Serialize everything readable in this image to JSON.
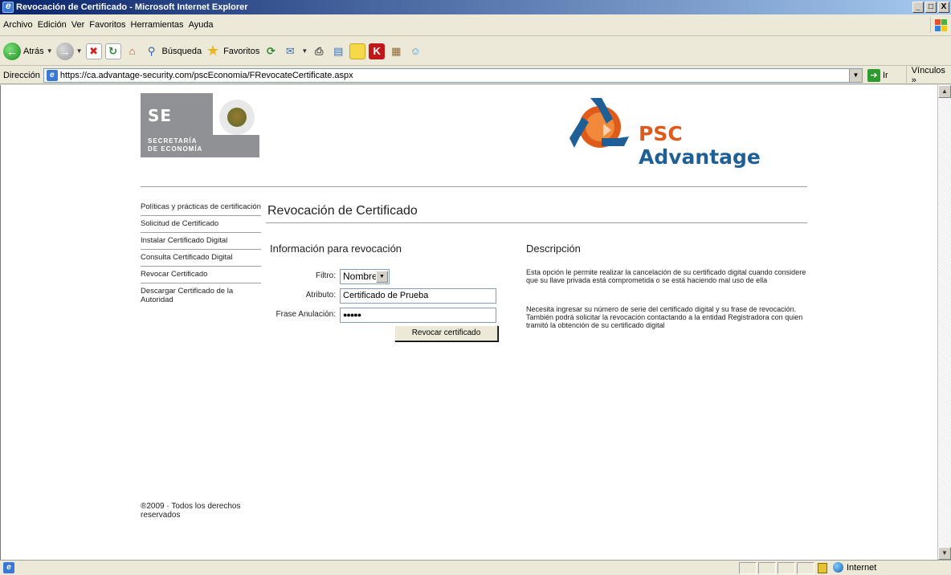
{
  "window": {
    "title": "Revocación de Certificado - Microsoft Internet Explorer",
    "buttons": [
      "_",
      "□",
      "X"
    ]
  },
  "menu": {
    "items": [
      "Archivo",
      "Edición",
      "Ver",
      "Favoritos",
      "Herramientas",
      "Ayuda"
    ]
  },
  "toolbar": {
    "back_label": "Atrás",
    "search_label": "Búsqueda",
    "favorites_label": "Favoritos"
  },
  "address": {
    "label": "Dirección",
    "url": "https://ca.advantage-security.com/pscEconomia/FRevocateCertificate.aspx",
    "go_label": "Ir",
    "links_label": "Vínculos"
  },
  "page": {
    "logo_se": {
      "abbr": "SE",
      "line1": "SECRETARÍA",
      "line2": "DE ECONOMÍA"
    },
    "logo_psc": {
      "psc": "PSC",
      "advantage": "Advantage"
    },
    "sidebar": [
      "Políticas y prácticas de certificación",
      "Solicitud de Certificado",
      "Instalar Certificado Digital",
      "Consulta Certificado Digital",
      "Revocar Certificado",
      "Descargar Certificado de la Autoridad"
    ],
    "title": "Revocación de Certificado",
    "form": {
      "heading": "Información para revocación",
      "filter_label": "Filtro:",
      "filter_value": "Nombre",
      "attribute_label": "Atributo:",
      "attribute_value": "Certificado de Prueba",
      "phrase_label": "Frase Anulación:",
      "phrase_value": "●●●●●",
      "submit_label": "Revocar certificado"
    },
    "description": {
      "heading": "Descripción",
      "p1": "Esta opción le permite realizar la cancelación de su certificado digital cuando considere que su llave privada está comprometida o se está haciendo mal uso de ella",
      "p2": "Necesita ingresar su número de serie del certificado digital y su frase de revocación. También podrá solicitar la revocación contactando a la entidad Registradora con quien tramitó la obtención de su certificado digital"
    },
    "footer": "®2009 · Todos los derechos reservados"
  },
  "status": {
    "zone": "Internet"
  }
}
